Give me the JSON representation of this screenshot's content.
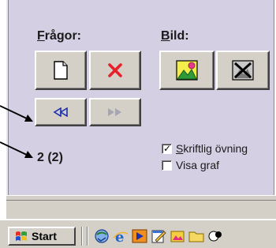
{
  "sections": {
    "questions": {
      "label_first": "F",
      "label_rest": "rågor:"
    },
    "image": {
      "label_first": "B",
      "label_rest": "ild:"
    }
  },
  "counter": "2 (2)",
  "checkboxes": [
    {
      "label_first": "S",
      "label_rest": "kriftlig övning",
      "checked": true
    },
    {
      "label_prefix": "Visa ",
      "label_first": "g",
      "label_rest": "raf",
      "checked": false
    }
  ],
  "taskbar": {
    "start_label": "Start"
  },
  "colors": {
    "window_bg": "#d4cfe2",
    "button_face": "#d4d0c8",
    "delete_red": "#e8202a",
    "nav_blue": "#1b2fb0"
  },
  "icons": {
    "new_question": "new-document-icon",
    "delete_question": "red-x-icon",
    "image_add": "image-landscape-icon",
    "image_delete": "image-crossed-icon",
    "nav_back": "rewind-icon",
    "nav_forward": "fast-forward-icon"
  }
}
